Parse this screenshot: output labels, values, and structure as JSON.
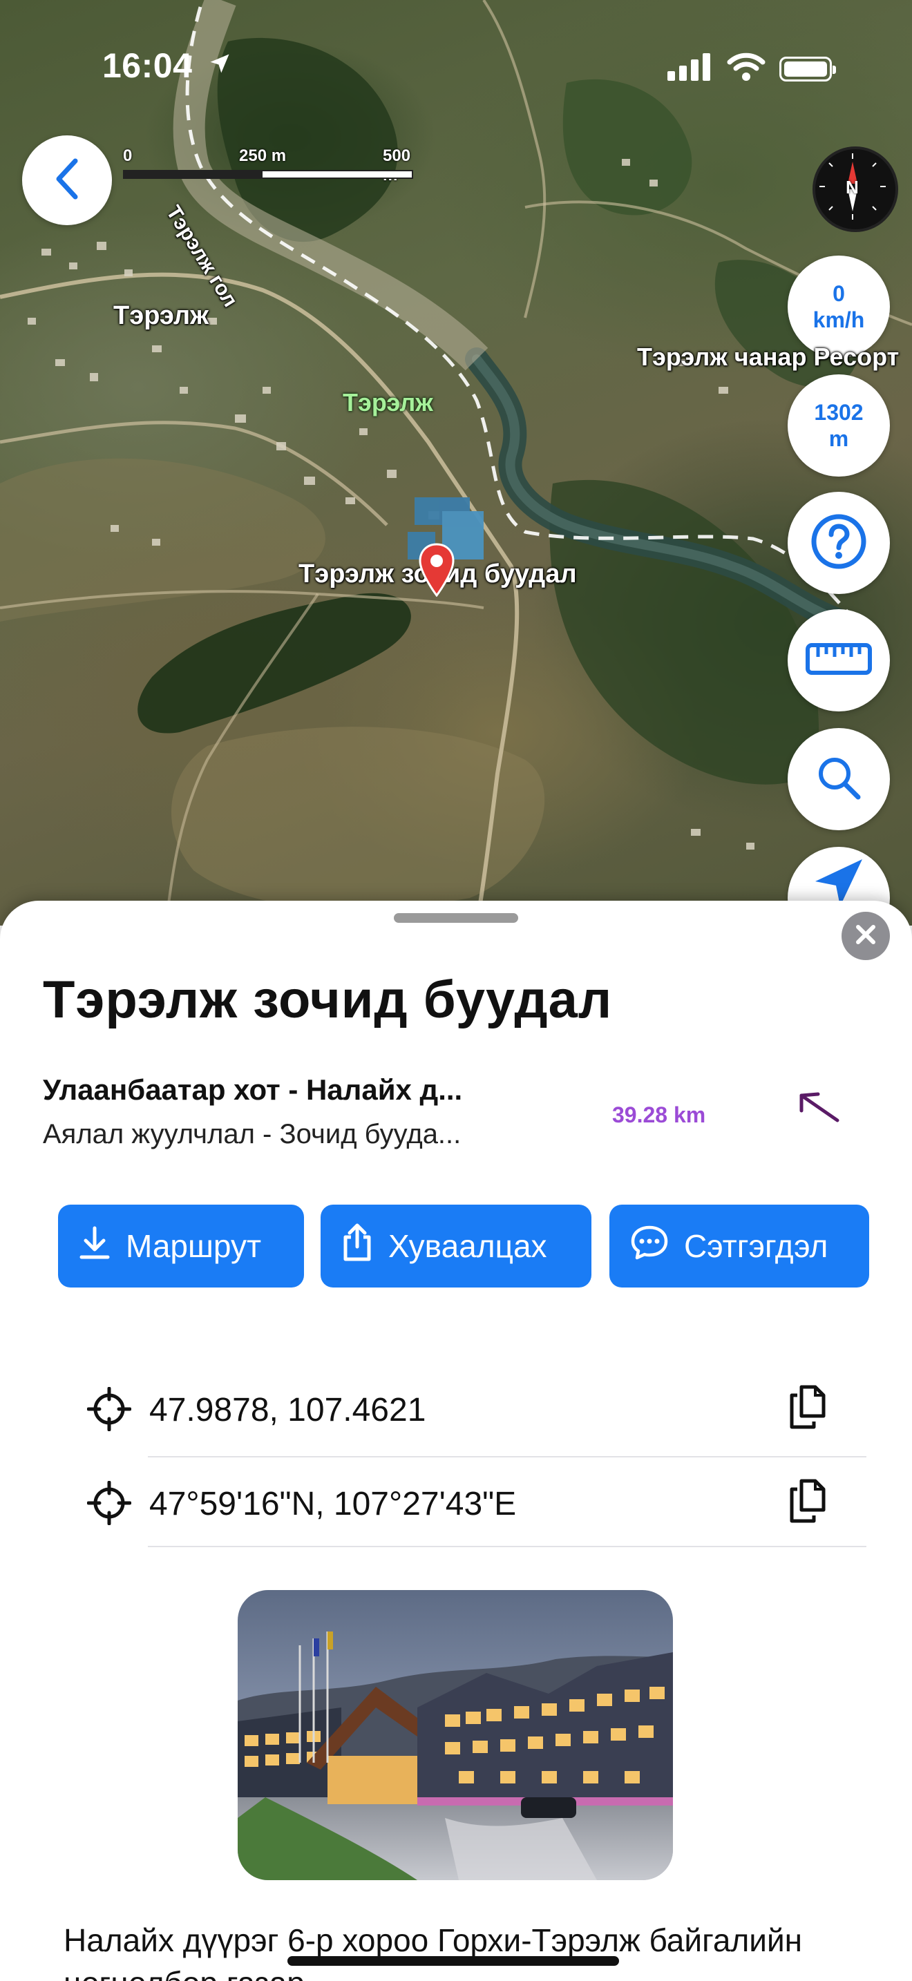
{
  "status_bar": {
    "time": "16:04"
  },
  "map": {
    "scale": {
      "labels": [
        "0",
        "250 m",
        "500 m"
      ]
    },
    "compass_label": "N",
    "speed": {
      "value": "0",
      "unit": "km/h"
    },
    "altitude": {
      "value": "1302",
      "unit": "m"
    },
    "labels": {
      "river": "Тэрэлж гол",
      "town_white": "Тэрэлж",
      "town_green": "Тэрэлж",
      "resort": "Тэрэлж чанар Ресорт",
      "hotel_pin": "Тэрэлж зочид буудал"
    },
    "icons": [
      "back-icon",
      "compass-icon",
      "help-icon",
      "ruler-icon",
      "search-icon",
      "navigate-icon",
      "location-arrow-icon",
      "signal-icon",
      "wifi-icon",
      "battery-icon"
    ]
  },
  "sheet": {
    "title": "Тэрэлж зочид буудал",
    "address_line": "Улаанбаатар хот - Налайх д...",
    "category_line": "Аялал жуулчлал - Зочид бууда...",
    "distance": "39.28 km",
    "actions": {
      "route": "Маршрут",
      "share": "Хуваалцах",
      "review": "Сэтгэгдэл"
    },
    "coordinates": {
      "decimal": "47.9878, 107.4621",
      "dms": "47°59'16\"N, 107°27'43\"E"
    },
    "description": "Налайх дүүрэг 6-р хороо Горхи-Тэрэлж байгалийн цогцолбор газар"
  },
  "colors": {
    "accent": "#1a7cf5",
    "distance": "#9b4bd6",
    "pin": "#e53935"
  }
}
